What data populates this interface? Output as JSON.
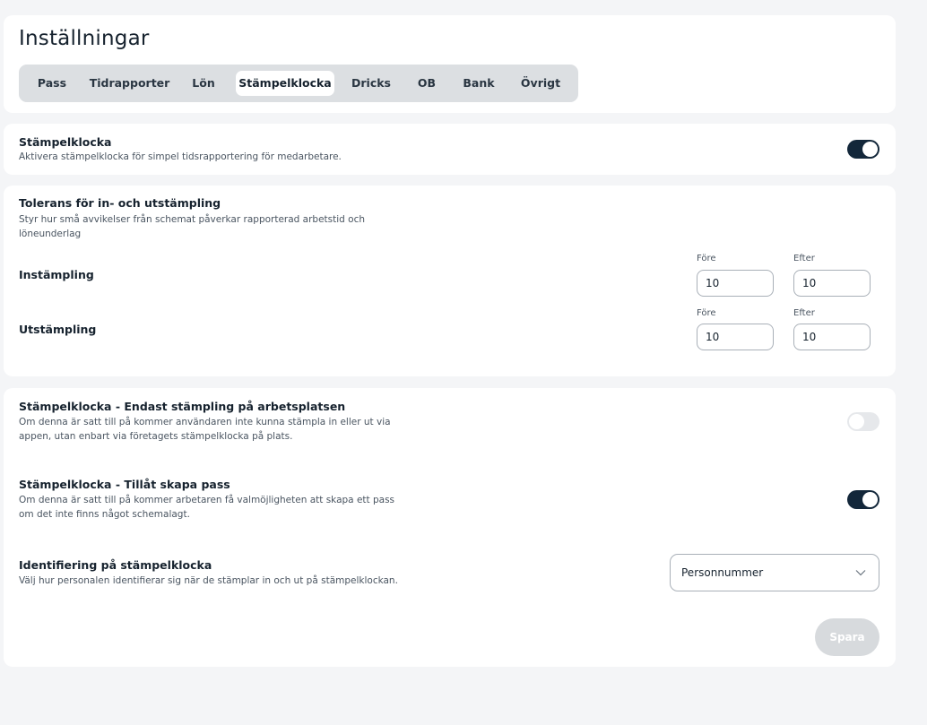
{
  "page": {
    "title": "Inställningar"
  },
  "tabs": [
    {
      "label": "Pass"
    },
    {
      "label": "Tidrapporter"
    },
    {
      "label": "Lön"
    },
    {
      "label": "Stämpelklocka",
      "active": true
    },
    {
      "label": "Dricks"
    },
    {
      "label": "OB"
    },
    {
      "label": "Bank"
    },
    {
      "label": "Övrigt"
    }
  ],
  "punch_clock": {
    "title": "Stämpelklocka",
    "description": "Aktivera stämpelklocka för simpel tidsrapportering för medarbetare.",
    "enabled": true
  },
  "tolerance": {
    "title": "Tolerans för in- och utstämpling",
    "description": "Styr hur små avvikelser från schemat påverkar rapporterad arbetstid och löneunderlag",
    "clock_in": {
      "label": "Instämpling",
      "before_label": "Före",
      "after_label": "Efter",
      "before": "10",
      "after": "10"
    },
    "clock_out": {
      "label": "Utstämpling",
      "before_label": "Före",
      "after_label": "Efter",
      "before": "10",
      "after": "10"
    }
  },
  "onsite_only": {
    "title": "Stämpelklocka - Endast stämpling på arbetsplatsen",
    "description": "Om denna är satt till på kommer användaren inte kunna stämpla in eller ut via appen, utan enbart via företagets stämpelklocka på plats.",
    "enabled": false
  },
  "allow_create_shift": {
    "title": "Stämpelklocka - Tillåt skapa pass",
    "description": "Om denna är satt till på kommer arbetaren få valmöjligheten att skapa ett pass om det inte finns något schemalagt.",
    "enabled": true
  },
  "identification": {
    "title": "Identifiering på stämpelklocka",
    "description": "Välj hur personalen identifierar sig när de stämplar in och ut på stämpelklockan.",
    "selected": "Personnummer"
  },
  "actions": {
    "save_label": "Spara"
  },
  "icons": {
    "dropdown": "chevron-down-icon"
  },
  "colors": {
    "primary": "#13273a",
    "background": "#f4f5f7",
    "disabled_button": "#d7dadd"
  }
}
